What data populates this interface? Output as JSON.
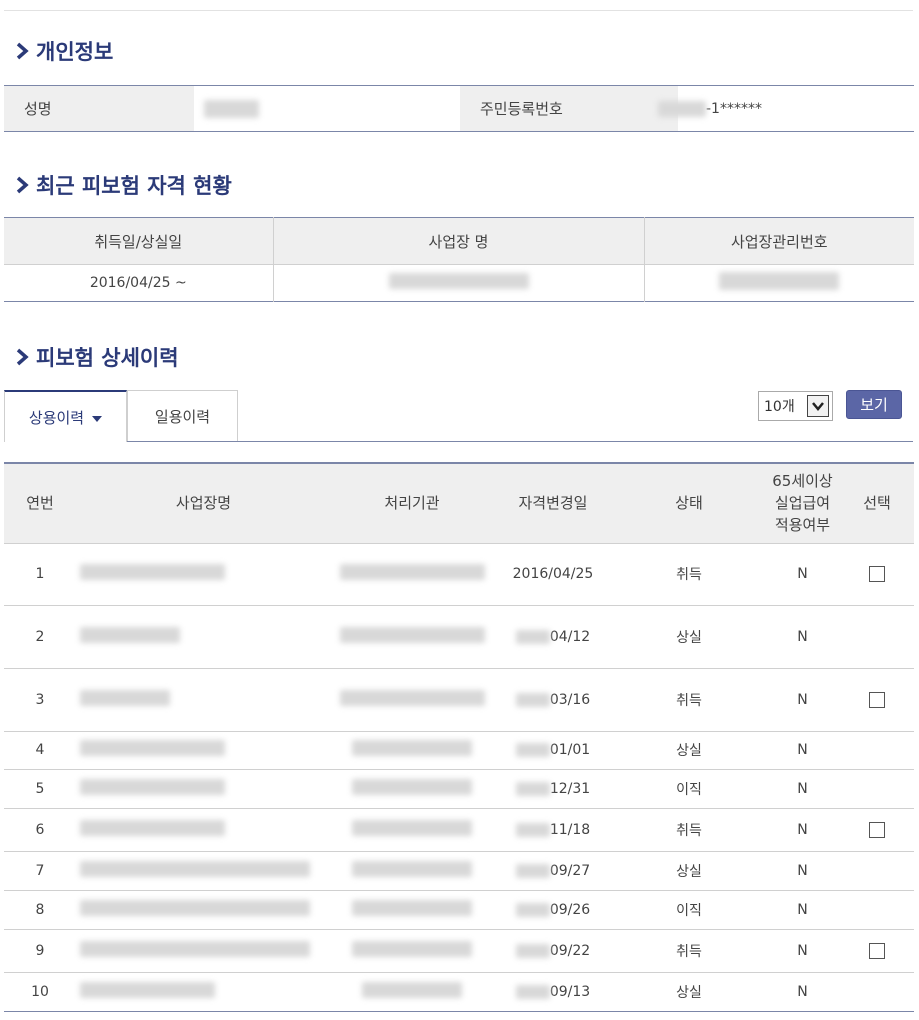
{
  "sections": {
    "personal": "개인정보",
    "recent": "최근 피보험 자격 현황",
    "history": "피보험 상세이력"
  },
  "personal": {
    "name_label": "성명",
    "rrn_label": "주민등록번호",
    "rrn_suffix": "-1******"
  },
  "recent": {
    "headers": [
      "취득일/상실일",
      "사업장 명",
      "사업장관리번호"
    ],
    "row": {
      "date": "2016/04/25 ~"
    }
  },
  "tabs": {
    "active": "상용이력",
    "inactive": "일용이력"
  },
  "page_size": "10개",
  "view_button": "보기",
  "history": {
    "headers": [
      "연번",
      "사업장명",
      "처리기관",
      "자격변경일",
      "상태",
      "65세이상 실업급여 적용여부",
      "선택"
    ],
    "rows": [
      {
        "no": "1",
        "date": "2016/04/25",
        "status": "취득",
        "flag": "N",
        "checkbox": true
      },
      {
        "no": "2",
        "date": "04/12",
        "status": "상실",
        "flag": "N",
        "checkbox": false
      },
      {
        "no": "3",
        "date": "03/16",
        "status": "취득",
        "flag": "N",
        "checkbox": true
      },
      {
        "no": "4",
        "date": "01/01",
        "status": "상실",
        "flag": "N",
        "checkbox": false
      },
      {
        "no": "5",
        "date": "12/31",
        "status": "이직",
        "flag": "N",
        "checkbox": false
      },
      {
        "no": "6",
        "date": "11/18",
        "status": "취득",
        "flag": "N",
        "checkbox": true
      },
      {
        "no": "7",
        "date": "09/27",
        "status": "상실",
        "flag": "N",
        "checkbox": false
      },
      {
        "no": "8",
        "date": "09/26",
        "status": "이직",
        "flag": "N",
        "checkbox": false
      },
      {
        "no": "9",
        "date": "09/22",
        "status": "취득",
        "flag": "N",
        "checkbox": true
      },
      {
        "no": "10",
        "date": "09/13",
        "status": "상실",
        "flag": "N",
        "checkbox": false
      }
    ]
  },
  "colors": {
    "accent": "#2b3a78",
    "button": "#5b66a6",
    "header_bg": "#efefef"
  }
}
